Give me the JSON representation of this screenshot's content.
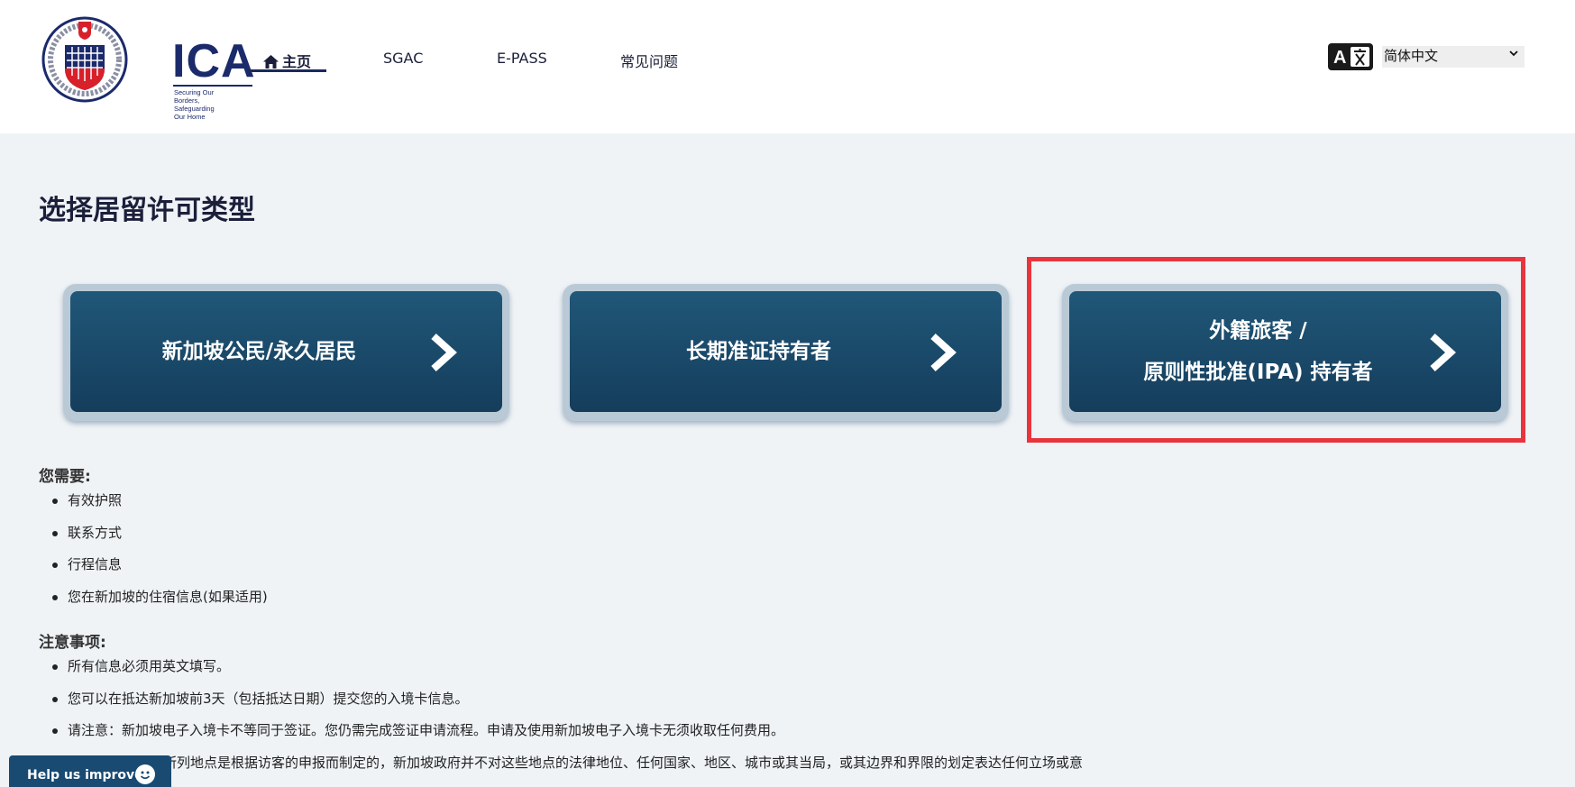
{
  "header": {
    "logo_text": "ICA",
    "logo_tagline": "Securing Our Borders,\nSafeguarding Our Home",
    "logo_ring_text": "IMMIGRATION & CHECKPOINTS AUTHORITY SINGAPORE",
    "nav": {
      "home": "主页",
      "sgac": "SGAC",
      "epass": "E-PASS",
      "faq": "常见问题"
    },
    "language": {
      "selected": "简体中文",
      "icon": "translate-icon"
    }
  },
  "main": {
    "title": "选择居留许可类型",
    "cards": [
      {
        "label": "新加坡公民/永久居民",
        "icon": "chevron-right-icon"
      },
      {
        "label": "长期准证持有者",
        "icon": "chevron-right-icon"
      },
      {
        "label_line1": "外籍旅客 /",
        "label_line2": "原则性批准(IPA) 持有者",
        "icon": "chevron-right-icon"
      }
    ],
    "highlight_color": "#e8343d",
    "requirements": {
      "heading": "您需要:",
      "items": [
        "有效护照",
        "联系方式",
        "行程信息",
        "您在新加坡的住宿信息(如果适用)"
      ]
    },
    "notes": {
      "heading": "注意事项:",
      "items": [
        "所有信息必须用英文填写。",
        "您可以在抵达新加坡前3天（包括抵达日期）提交您的入境卡信息。",
        "请注意：新加坡电子入境卡不等同于签证。您仍需完成签证申请流程。申请及使用新加坡电子入境卡无须收取任何费用。",
        "的下拉菜单所列地点是根据访客的申报而制定的，新加坡政府并不对这些地点的法律地位、任何国家、地区、城市或其当局，或其边界和界限的划定表达任何立场或意"
      ]
    }
  },
  "feedback": {
    "label": "Help us improve",
    "icon": "smiley-icon"
  },
  "colors": {
    "card_top": "#205778",
    "card_bottom": "#153d5c",
    "brand_navy": "#1b2a6b",
    "feedback_bg": "#184a72"
  }
}
